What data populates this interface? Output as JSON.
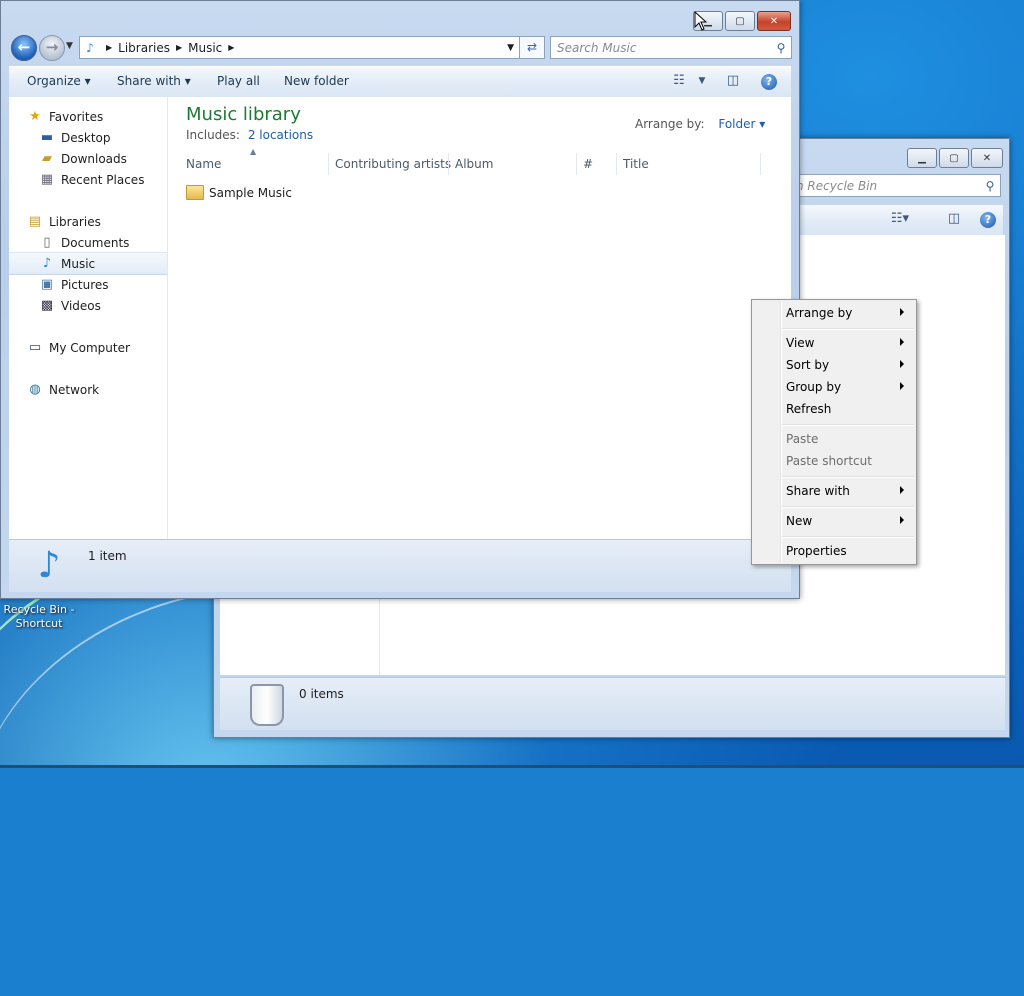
{
  "desktop": {
    "icon_label_line1": "Recycle Bin -",
    "icon_label_line2": "Shortcut"
  },
  "music_window": {
    "address": {
      "crumbs": [
        "Libraries",
        "Music"
      ]
    },
    "search_placeholder": "Search Music",
    "toolbar": {
      "organize": "Organize",
      "share_with": "Share with",
      "play_all": "Play all",
      "new_folder": "New folder",
      "help": "?"
    },
    "nav": {
      "favorites": "Favorites",
      "desktop": "Desktop",
      "downloads": "Downloads",
      "recent_places": "Recent Places",
      "libraries": "Libraries",
      "documents": "Documents",
      "music": "Music",
      "pictures": "Pictures",
      "videos": "Videos",
      "my_computer": "My Computer",
      "network": "Network"
    },
    "library": {
      "title": "Music library",
      "includes_label": "Includes:",
      "locations_link": "2 locations",
      "arrange_label": "Arrange by:",
      "arrange_value": "Folder"
    },
    "columns": [
      "Name",
      "Contributing artists",
      "Album",
      "#",
      "Title"
    ],
    "files": [
      {
        "name": "Sample Music"
      }
    ],
    "status": "1 item"
  },
  "recycle_window": {
    "search_placeholder": "h Recycle Bin",
    "status": "0 items",
    "help": "?"
  },
  "context_menu": {
    "items": [
      {
        "label": "Arrange by",
        "submenu": true,
        "enabled": true
      },
      {
        "label": "View",
        "submenu": true,
        "enabled": true
      },
      {
        "label": "Sort by",
        "submenu": true,
        "enabled": true
      },
      {
        "label": "Group by",
        "submenu": true,
        "enabled": true
      },
      {
        "label": "Refresh",
        "submenu": false,
        "enabled": true
      },
      {
        "label": "Paste",
        "submenu": false,
        "enabled": false
      },
      {
        "label": "Paste shortcut",
        "submenu": false,
        "enabled": false
      },
      {
        "label": "Share with",
        "submenu": true,
        "enabled": true
      },
      {
        "label": "New",
        "submenu": true,
        "enabled": true
      },
      {
        "label": "Properties",
        "submenu": false,
        "enabled": true
      }
    ]
  }
}
